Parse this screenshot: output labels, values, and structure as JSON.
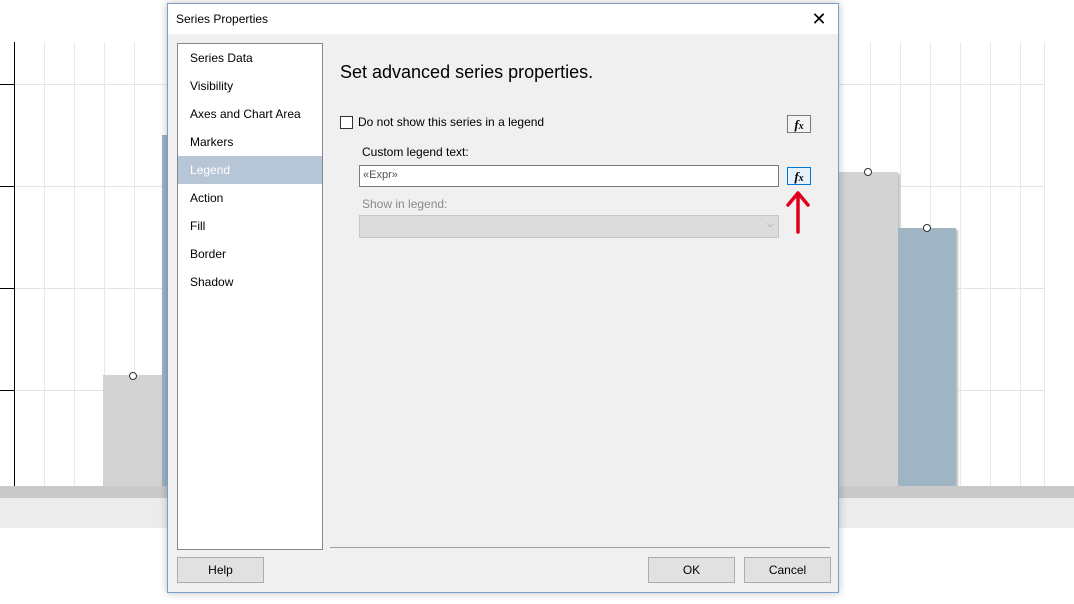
{
  "dialog": {
    "title": "Series Properties",
    "close_glyph": "✕"
  },
  "nav": {
    "items": [
      {
        "label": "Series Data"
      },
      {
        "label": "Visibility"
      },
      {
        "label": "Axes and Chart Area"
      },
      {
        "label": "Markers"
      },
      {
        "label": "Legend",
        "selected": true
      },
      {
        "label": "Action"
      },
      {
        "label": "Fill"
      },
      {
        "label": "Border"
      },
      {
        "label": "Shadow"
      }
    ]
  },
  "main": {
    "heading": "Set advanced series properties.",
    "hide_in_legend_label": "Do not show this series in a legend",
    "hide_in_legend_checked": false,
    "custom_legend_label": "Custom legend text:",
    "custom_legend_value": "«Expr»",
    "show_in_legend_label": "Show in legend:",
    "show_in_legend_value": "",
    "fx_label": "fx"
  },
  "buttons": {
    "help": "Help",
    "ok": "OK",
    "cancel": "Cancel"
  },
  "annotation": {
    "color": "#e0001b",
    "icon": "up-arrow-icon"
  },
  "colors": {
    "selected_nav": "#b7c6d6",
    "bar_gray": "#d3d3d3",
    "bar_blue": "#9fb5c3",
    "fx_highlight": "#0078d7"
  }
}
